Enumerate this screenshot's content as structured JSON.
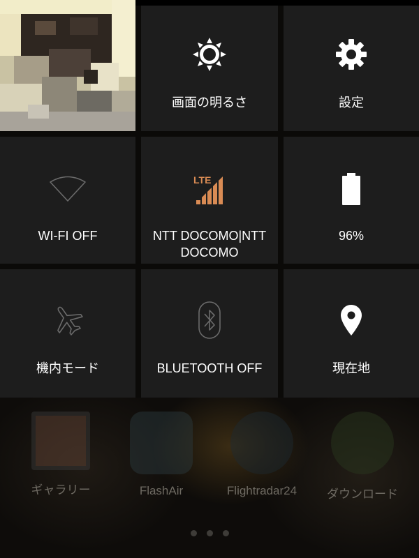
{
  "quick_settings": {
    "row1": {
      "brightness_label": "画面の明るさ",
      "settings_label": "設定"
    },
    "row2": {
      "wifi_label": "WI-FI OFF",
      "carrier_label": "NTT DOCOMO|NTT DOCOMO",
      "lte_text": "LTE",
      "battery_label": "96%"
    },
    "row3": {
      "airplane_label": "機内モード",
      "bluetooth_label": "BLUETOOTH OFF",
      "location_label": "現在地"
    }
  },
  "home_screen": {
    "apps": [
      {
        "label": "ギャラリー",
        "icon": "gallery-icon"
      },
      {
        "label": "FlashAir",
        "icon": "flashair-icon"
      },
      {
        "label": "Flightradar24",
        "icon": "radar-icon"
      },
      {
        "label": "ダウンロード",
        "icon": "download-icon"
      }
    ]
  },
  "colors": {
    "tile_bg": "#1d1d1d",
    "lte_accent": "#d98b54",
    "inactive_icon": "#6b6b6b",
    "active_icon": "#ffffff"
  }
}
